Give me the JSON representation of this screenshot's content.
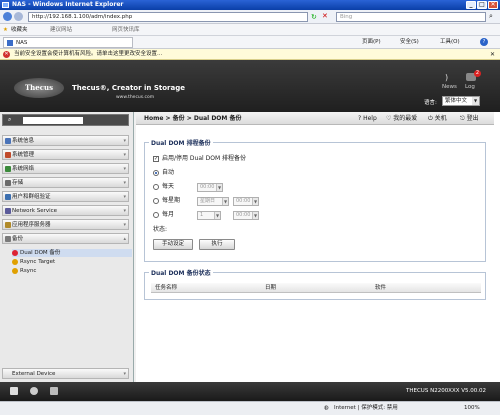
{
  "window": {
    "title": "NAS - Windows Internet Explorer",
    "min": "_",
    "max": "□",
    "close": "✕"
  },
  "address": {
    "url": "http://192.168.1.100/adm/index.php",
    "search_placeholder": "Bing"
  },
  "favbar": {
    "favorites": "收藏夹",
    "suggested": "建议网站",
    "gallery": "网页快讯库"
  },
  "tab": {
    "title": "NAS",
    "menus": [
      "页面(P)",
      "安全(S)",
      "工具(O)"
    ]
  },
  "warning": "当前安全设置会使计算机有风险。请单击这里更改安全设置...",
  "header": {
    "logo": "Thecus",
    "tagline": "Thecus®, Creator in Storage",
    "site": "www.thecus.com",
    "news_label": "News",
    "log_label": "Log",
    "log_count": "2",
    "lang_label": "语言:",
    "lang_value": "繁体中文"
  },
  "sidebar": {
    "search_value": "",
    "items": [
      {
        "label": "系统信息",
        "color": "#4a73b8"
      },
      {
        "label": "系统管理",
        "color": "#c04a2a"
      },
      {
        "label": "系统网络",
        "color": "#3a8a3a"
      },
      {
        "label": "存储",
        "color": "#6b6b6b"
      },
      {
        "label": "用户和群组验证",
        "color": "#3c6fb0"
      },
      {
        "label": "Network Service",
        "color": "#5a5a9a"
      },
      {
        "label": "应用程序服务器",
        "color": "#b08a2a"
      },
      {
        "label": "备份",
        "color": "#7a7a7a"
      }
    ],
    "subitems": [
      "Dual DOM 备份",
      "Rsync Target",
      "Rsync"
    ],
    "external": "External Device"
  },
  "crumb": {
    "text": "Home > 备份 > Dual DOM 备份",
    "help": "Help",
    "favorites": "我的最爱",
    "shutdown": "关机",
    "logout": "登出"
  },
  "dual_dom": {
    "title": "Dual DOM 排程备份",
    "enable_label": "启用/停用 Dual DOM 排程备份",
    "options": [
      "自动",
      "每天",
      "每星期",
      "每月"
    ],
    "daily_time": "00:00",
    "weekly_day": "星期日",
    "weekly_time": "00:00",
    "monthly_day": "1",
    "monthly_time": "00:00",
    "status_label": "状态:",
    "manual_button": "手动设定",
    "run_button": "执行"
  },
  "status_panel": {
    "title": "Dual DOM 备份状态",
    "columns": [
      "任务名称",
      "日期",
      "软件"
    ]
  },
  "footer": {
    "model": "THECUS N2200XXX V5.00.02"
  },
  "statusbar": {
    "zone": "Internet | 保护模式: 禁用",
    "zoom": "100%"
  }
}
